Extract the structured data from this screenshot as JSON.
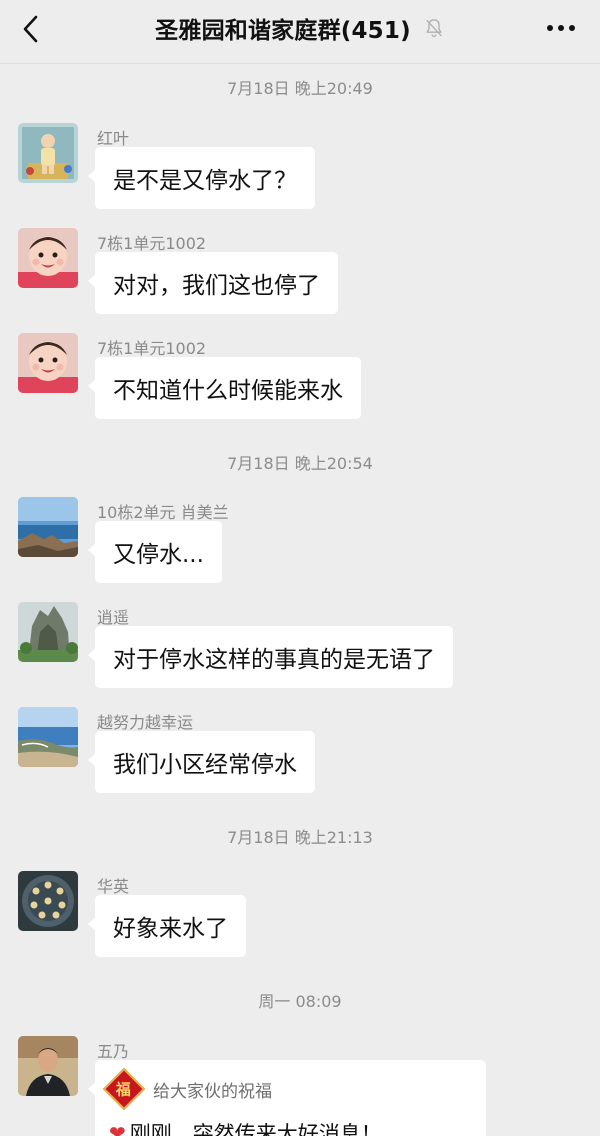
{
  "header": {
    "title": "圣雅园和谐家庭群(451)"
  },
  "timestamps": [
    "7月18日 晚上20:49",
    "7月18日 晚上20:54",
    "7月18日 晚上21:13",
    "周一 08:09"
  ],
  "messages": [
    {
      "sender": "红叶",
      "text": "是不是又停水了？"
    },
    {
      "sender": "7栋1单元1002",
      "text": "对对，我们这也停了"
    },
    {
      "sender": "7栋1单元1002",
      "text": "不知道什么时候能来水"
    },
    {
      "sender": "10栋2单元 肖美兰",
      "text": "又停水..."
    },
    {
      "sender": "逍遥",
      "text": "对于停水这样的事真的是无语了"
    },
    {
      "sender": "越努力越幸运",
      "text": "我们小区经常停水"
    },
    {
      "sender": "华英",
      "text": "好象来水了"
    },
    {
      "sender": "五乃",
      "card_title": "给大家伙的祝福",
      "card_icon": "福",
      "card_body": "刚刚，突然传来大好消息！"
    }
  ],
  "colors": {
    "background": "#ededed",
    "bubble": "#ffffff",
    "timestamp": "#8c8c8c",
    "sender": "#8a8a8a"
  }
}
